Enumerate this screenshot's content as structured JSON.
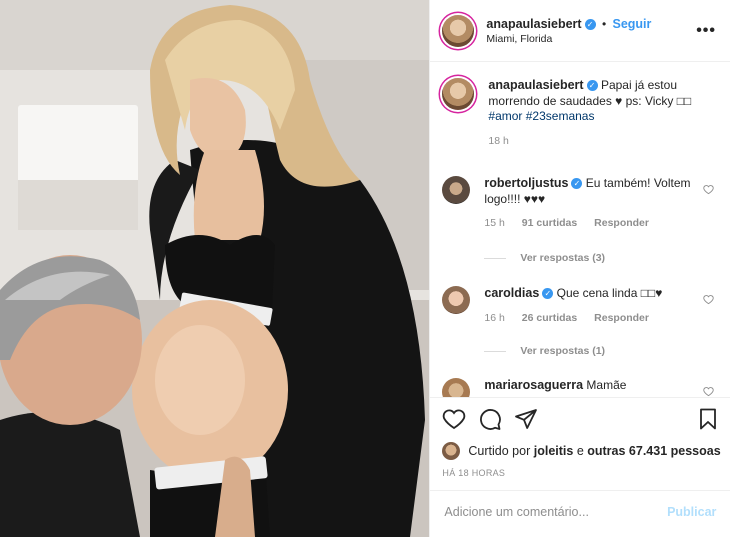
{
  "post": {
    "author": "anapaulasiebert",
    "follow_label": "Seguir",
    "separator": "•",
    "location": "Miami, Florida",
    "more_label": "•••"
  },
  "caption": {
    "author": "anapaulasiebert",
    "text": "Papai já estou morrendo de saudades ♥ ps: Vicky □□",
    "tags": "#amor #23semanas",
    "time": "18 h"
  },
  "comments": [
    {
      "author": "robertoljustus",
      "text": "Eu também! Voltem logo!!!! ♥♥♥",
      "time": "15 h",
      "likes": "91 curtidas",
      "reply": "Responder",
      "view_replies": "Ver respostas (3)"
    },
    {
      "author": "caroldias",
      "text": "Que cena linda □□♥",
      "time": "16 h",
      "likes": "26 curtidas",
      "reply": "Responder",
      "view_replies": "Ver respostas (1)"
    },
    {
      "author": "mariarosaguerra",
      "text": "Mamãe"
    }
  ],
  "likes": {
    "prefix": "Curtido por",
    "user": "joleitis",
    "middle": "e",
    "rest": "outras 67.431 pessoas"
  },
  "posted_ago": "HÁ 18 HORAS",
  "comment_box": {
    "placeholder": "Adicione um comentário...",
    "publish_label": "Publicar"
  },
  "icons": [
    "heart-icon",
    "comment-icon",
    "share-icon",
    "bookmark-icon",
    "more-icon"
  ],
  "colors": {
    "accent": "#3897f0",
    "link": "#00376b",
    "muted": "#8e8e8e",
    "publish_disabled": "#b2dffc"
  }
}
